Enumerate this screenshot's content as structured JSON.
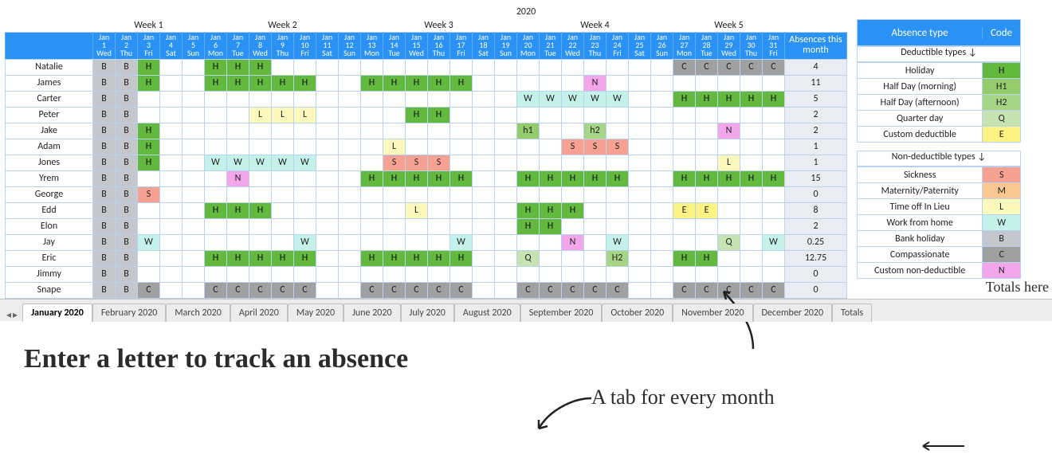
{
  "year": "2020",
  "weeks": [
    "Week 1",
    "Week 2",
    "Week 3",
    "Week 4",
    "Week 5"
  ],
  "days": [
    {
      "m": "Jan",
      "d": "1",
      "w": "Wed"
    },
    {
      "m": "Jan",
      "d": "2",
      "w": "Thu"
    },
    {
      "m": "Jan",
      "d": "3",
      "w": "Fri"
    },
    {
      "m": "Jan",
      "d": "4",
      "w": "Sat"
    },
    {
      "m": "Jan",
      "d": "5",
      "w": "Sun"
    },
    {
      "m": "Jan",
      "d": "6",
      "w": "Mon"
    },
    {
      "m": "Jan",
      "d": "7",
      "w": "Tue"
    },
    {
      "m": "Jan",
      "d": "8",
      "w": "Wed"
    },
    {
      "m": "Jan",
      "d": "9",
      "w": "Thu"
    },
    {
      "m": "Jan",
      "d": "10",
      "w": "Fri"
    },
    {
      "m": "Jan",
      "d": "11",
      "w": "Sat"
    },
    {
      "m": "Jan",
      "d": "12",
      "w": "Sun"
    },
    {
      "m": "Jan",
      "d": "13",
      "w": "Mon"
    },
    {
      "m": "Jan",
      "d": "14",
      "w": "Tue"
    },
    {
      "m": "Jan",
      "d": "15",
      "w": "Wed"
    },
    {
      "m": "Jan",
      "d": "16",
      "w": "Thu"
    },
    {
      "m": "Jan",
      "d": "17",
      "w": "Fri"
    },
    {
      "m": "Jan",
      "d": "18",
      "w": "Sat"
    },
    {
      "m": "Jan",
      "d": "19",
      "w": "Sun"
    },
    {
      "m": "Jan",
      "d": "20",
      "w": "Mon"
    },
    {
      "m": "Jan",
      "d": "21",
      "w": "Tue"
    },
    {
      "m": "Jan",
      "d": "22",
      "w": "Wed"
    },
    {
      "m": "Jan",
      "d": "23",
      "w": "Thu"
    },
    {
      "m": "Jan",
      "d": "24",
      "w": "Fri"
    },
    {
      "m": "Jan",
      "d": "25",
      "w": "Sat"
    },
    {
      "m": "Jan",
      "d": "26",
      "w": "Sun"
    },
    {
      "m": "Jan",
      "d": "27",
      "w": "Mon"
    },
    {
      "m": "Jan",
      "d": "28",
      "w": "Tue"
    },
    {
      "m": "Jan",
      "d": "29",
      "w": "Wed"
    },
    {
      "m": "Jan",
      "d": "30",
      "w": "Thu"
    },
    {
      "m": "Jan",
      "d": "31",
      "w": "Fri"
    }
  ],
  "absences_header": "Absences this month",
  "people": [
    {
      "name": "Natalie",
      "total": "4",
      "cells": [
        "B",
        "B",
        "H",
        "",
        "",
        "H",
        "H",
        "H",
        "",
        "",
        "",
        "",
        "",
        "",
        "",
        "",
        "",
        "",
        "",
        "",
        "",
        "",
        "",
        "",
        "",
        "",
        "C",
        "C",
        "C",
        "C",
        "C"
      ]
    },
    {
      "name": "James",
      "total": "11",
      "cells": [
        "B",
        "B",
        "H",
        "",
        "",
        "H",
        "H",
        "H",
        "H",
        "H",
        "",
        "",
        "H",
        "H",
        "H",
        "H",
        "H",
        "",
        "",
        "",
        "",
        "",
        "N",
        "",
        "",
        "",
        "",
        "",
        "",
        "",
        ""
      ]
    },
    {
      "name": "Carter",
      "total": "5",
      "cells": [
        "B",
        "B",
        "",
        "",
        "",
        "",
        "",
        "",
        "",
        "",
        "",
        "",
        "",
        "",
        "",
        "",
        "",
        "",
        "",
        "W",
        "W",
        "W",
        "W",
        "W",
        "",
        "",
        "H",
        "H",
        "H",
        "H",
        "H"
      ]
    },
    {
      "name": "Peter",
      "total": "2",
      "cells": [
        "B",
        "B",
        "",
        "",
        "",
        "",
        "",
        "L",
        "L",
        "L",
        "",
        "",
        "",
        "",
        "H",
        "H",
        "",
        "",
        "",
        "",
        "",
        "",
        "",
        "",
        "",
        "",
        "",
        "",
        "",
        "",
        ""
      ]
    },
    {
      "name": "Jake",
      "total": "2",
      "cells": [
        "B",
        "B",
        "H",
        "",
        "",
        "",
        "",
        "",
        "",
        "",
        "",
        "",
        "",
        "",
        "",
        "",
        "",
        "",
        "",
        "h1",
        "",
        "",
        "h2",
        "",
        "",
        "",
        "",
        "",
        "N",
        "",
        ""
      ]
    },
    {
      "name": "Adam",
      "total": "1",
      "cells": [
        "B",
        "B",
        "H",
        "",
        "",
        "",
        "",
        "",
        "",
        "",
        "",
        "",
        "",
        "L",
        "",
        "",
        "",
        "",
        "",
        "",
        "",
        "S",
        "S",
        "S",
        "",
        "",
        "",
        "",
        "",
        "",
        ""
      ]
    },
    {
      "name": "Jones",
      "total": "1",
      "cells": [
        "B",
        "B",
        "H",
        "",
        "",
        "W",
        "W",
        "W",
        "W",
        "W",
        "",
        "",
        "",
        "S",
        "S",
        "S",
        "",
        "",
        "",
        "",
        "",
        "",
        "",
        "",
        "",
        "",
        "",
        "",
        "L",
        "",
        ""
      ]
    },
    {
      "name": "Yrem",
      "total": "15",
      "cells": [
        "B",
        "B",
        "",
        "",
        "",
        "",
        "N",
        "",
        "",
        "",
        "",
        "",
        "H",
        "H",
        "H",
        "H",
        "H",
        "",
        "",
        "H",
        "H",
        "H",
        "H",
        "H",
        "",
        "",
        "H",
        "H",
        "H",
        "H",
        "H"
      ]
    },
    {
      "name": "George",
      "total": "0",
      "cells": [
        "B",
        "B",
        "S",
        "",
        "",
        "",
        "",
        "",
        "",
        "",
        "",
        "",
        "",
        "",
        "",
        "",
        "",
        "",
        "",
        "",
        "",
        "",
        "",
        "",
        "",
        "",
        "",
        "",
        "",
        "",
        ""
      ]
    },
    {
      "name": "Edd",
      "total": "8",
      "cells": [
        "B",
        "B",
        "",
        "",
        "",
        "H",
        "H",
        "H",
        "",
        "",
        "",
        "",
        "",
        "",
        "L",
        "",
        "",
        "",
        "",
        "H",
        "H",
        "H",
        "",
        "",
        "",
        "",
        "E",
        "E",
        "",
        "",
        ""
      ]
    },
    {
      "name": "Elon",
      "total": "2",
      "cells": [
        "B",
        "B",
        "",
        "",
        "",
        "",
        "",
        "",
        "",
        "",
        "",
        "",
        "",
        "",
        "",
        "",
        "",
        "",
        "",
        "H",
        "H",
        "",
        "",
        "",
        "",
        "",
        "",
        "",
        "",
        "",
        ""
      ]
    },
    {
      "name": "Jay",
      "total": "0.25",
      "cells": [
        "B",
        "B",
        "W",
        "",
        "",
        "",
        "",
        "",
        "",
        "W",
        "",
        "",
        "",
        "",
        "",
        "",
        "W",
        "",
        "",
        "",
        "",
        "N",
        "",
        "W",
        "",
        "",
        "",
        "",
        "Q",
        "",
        "W"
      ]
    },
    {
      "name": "Eric",
      "total": "12.75",
      "cells": [
        "B",
        "B",
        "",
        "",
        "",
        "H",
        "H",
        "H",
        "H",
        "H",
        "",
        "",
        "H",
        "H",
        "H",
        "H",
        "H",
        "",
        "",
        "Q",
        "",
        "",
        "",
        "H2",
        "",
        "",
        "H",
        "H",
        "",
        "",
        ""
      ]
    },
    {
      "name": "Jimmy",
      "total": "0",
      "cells": [
        "B",
        "B",
        "",
        "",
        "",
        "",
        "",
        "",
        "",
        "",
        "",
        "",
        "",
        "",
        "",
        "",
        "",
        "",
        "",
        "",
        "",
        "",
        "",
        "",
        "",
        "",
        "",
        "",
        "",
        "",
        ""
      ]
    },
    {
      "name": "Snape",
      "total": "0",
      "cells": [
        "B",
        "B",
        "C",
        "",
        "",
        "C",
        "C",
        "C",
        "C",
        "C",
        "",
        "",
        "C",
        "C",
        "C",
        "C",
        "C",
        "",
        "",
        "C",
        "C",
        "C",
        "C",
        "C",
        "",
        "",
        "C",
        "C",
        "C",
        "C",
        "C"
      ]
    }
  ],
  "side": {
    "head_type": "Absence type",
    "head_code": "Code",
    "ded_caption": "Deductible types ↓",
    "nonded_caption": "Non-deductible types ↓",
    "deductible": [
      {
        "label": "Holiday",
        "code": "H",
        "cls": "c-H"
      },
      {
        "label": "Half Day (morning)",
        "code": "H1",
        "cls": "c-H1"
      },
      {
        "label": "Half Day (afternoon)",
        "code": "H2",
        "cls": "c-H2"
      },
      {
        "label": "Quarter day",
        "code": "Q",
        "cls": "c-Q"
      },
      {
        "label": "Custom deductible",
        "code": "E",
        "cls": "c-E"
      }
    ],
    "nondeductible": [
      {
        "label": "Sickness",
        "code": "S",
        "cls": "c-S"
      },
      {
        "label": "Maternity/Paternity",
        "code": "M",
        "cls": "c-M"
      },
      {
        "label": "Time off In Lieu",
        "code": "L",
        "cls": "c-L"
      },
      {
        "label": "Work from home",
        "code": "W",
        "cls": "c-W"
      },
      {
        "label": "Bank holiday",
        "code": "B",
        "cls": "c-B"
      },
      {
        "label": "Compassionate",
        "code": "C",
        "cls": "c-C"
      },
      {
        "label": "Custom non-deductible",
        "code": "N",
        "cls": "c-N"
      }
    ]
  },
  "annotations": {
    "a1": "Enter a letter to track an absence",
    "a2": "A tab for every month",
    "a3": "Totals here"
  },
  "tabs": [
    {
      "label": "January 2020",
      "active": true
    },
    {
      "label": "February 2020"
    },
    {
      "label": "March 2020"
    },
    {
      "label": "April 2020"
    },
    {
      "label": "May 2020"
    },
    {
      "label": "June 2020"
    },
    {
      "label": "July 2020"
    },
    {
      "label": "August 2020"
    },
    {
      "label": "September 2020"
    },
    {
      "label": "October 2020"
    },
    {
      "label": "November 2020"
    },
    {
      "label": "December 2020"
    },
    {
      "label": "Totals"
    }
  ],
  "code_map": {
    "B": "c-B",
    "H": "c-H",
    "H1": "c-H1",
    "h1": "c-H1",
    "H2": "c-H2",
    "h2": "c-H2",
    "Q": "c-Q",
    "E": "c-E",
    "S": "c-S",
    "M": "c-M",
    "L": "c-L",
    "W": "c-W",
    "C": "c-C",
    "N": "c-N"
  }
}
